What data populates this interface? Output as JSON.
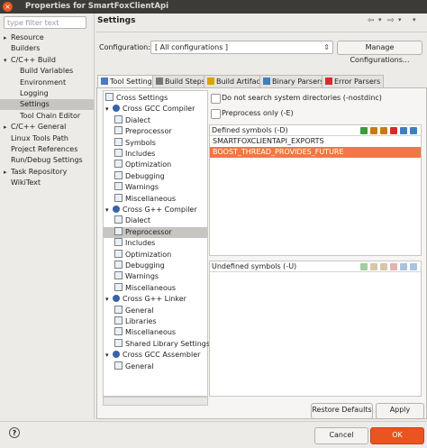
{
  "window": {
    "title": "Properties for SmartFoxClientApi",
    "close_glyph": "×"
  },
  "filter": {
    "placeholder": "type filter text"
  },
  "nav": {
    "items": [
      {
        "label": "Resource",
        "arrow": "▸"
      },
      {
        "label": "Builders",
        "arrow": ""
      },
      {
        "label": "C/C++ Build",
        "arrow": "▾"
      },
      {
        "label": "Build Variables",
        "arrow": ""
      },
      {
        "label": "Environment",
        "arrow": ""
      },
      {
        "label": "Logging",
        "arrow": ""
      },
      {
        "label": "Settings",
        "arrow": ""
      },
      {
        "label": "Tool Chain Editor",
        "arrow": ""
      },
      {
        "label": "C/C++ General",
        "arrow": "▸"
      },
      {
        "label": "Linux Tools Path",
        "arrow": ""
      },
      {
        "label": "Project References",
        "arrow": ""
      },
      {
        "label": "Run/Debug Settings",
        "arrow": ""
      },
      {
        "label": "Task Repository",
        "arrow": "▸"
      },
      {
        "label": "WikiText",
        "arrow": ""
      }
    ]
  },
  "header": {
    "title": "Settings",
    "back_glyph": "⇦",
    "back_menu_glyph": "▾",
    "fwd_glyph": "⇨",
    "fwd_menu_glyph": "▾",
    "more_glyph": "▾"
  },
  "configuration": {
    "label": "Configuration:",
    "value": "[ All configurations ]",
    "chevron": "⇕",
    "manage_label": "Manage Configurations..."
  },
  "tabs": [
    {
      "label": "Tool Settings",
      "icon_color": "#4a7bc2"
    },
    {
      "label": "Build Steps",
      "icon_color": "#777777"
    },
    {
      "label": "Build Artifact",
      "icon_color": "#d9a300"
    },
    {
      "label": "Binary Parsers",
      "icon_color": "#3f7fbf"
    },
    {
      "label": "Error Parsers",
      "icon_color": "#d22d2d"
    }
  ],
  "tool_tree": [
    {
      "label": "Cross Settings",
      "kind": "leaf",
      "indent": 0
    },
    {
      "label": "Cross GCC Compiler",
      "kind": "group",
      "indent": 0
    },
    {
      "label": "Dialect",
      "kind": "leaf",
      "indent": 1
    },
    {
      "label": "Preprocessor",
      "kind": "leaf",
      "indent": 1
    },
    {
      "label": "Symbols",
      "kind": "leaf",
      "indent": 1
    },
    {
      "label": "Includes",
      "kind": "leaf",
      "indent": 1
    },
    {
      "label": "Optimization",
      "kind": "leaf",
      "indent": 1
    },
    {
      "label": "Debugging",
      "kind": "leaf",
      "indent": 1
    },
    {
      "label": "Warnings",
      "kind": "leaf",
      "indent": 1
    },
    {
      "label": "Miscellaneous",
      "kind": "leaf",
      "indent": 1
    },
    {
      "label": "Cross G++ Compiler",
      "kind": "group",
      "indent": 0
    },
    {
      "label": "Dialect",
      "kind": "leaf",
      "indent": 1
    },
    {
      "label": "Preprocessor",
      "kind": "leaf",
      "indent": 1
    },
    {
      "label": "Includes",
      "kind": "leaf",
      "indent": 1
    },
    {
      "label": "Optimization",
      "kind": "leaf",
      "indent": 1
    },
    {
      "label": "Debugging",
      "kind": "leaf",
      "indent": 1
    },
    {
      "label": "Warnings",
      "kind": "leaf",
      "indent": 1
    },
    {
      "label": "Miscellaneous",
      "kind": "leaf",
      "indent": 1
    },
    {
      "label": "Cross G++ Linker",
      "kind": "group",
      "indent": 0
    },
    {
      "label": "General",
      "kind": "leaf",
      "indent": 1
    },
    {
      "label": "Libraries",
      "kind": "leaf",
      "indent": 1
    },
    {
      "label": "Miscellaneous",
      "kind": "leaf",
      "indent": 1
    },
    {
      "label": "Shared Library Settings",
      "kind": "leaf",
      "indent": 1
    },
    {
      "label": "Cross GCC Assembler",
      "kind": "group",
      "indent": 0
    },
    {
      "label": "General",
      "kind": "leaf",
      "indent": 1
    }
  ],
  "options": {
    "no_system_dirs": "Do not search system directories (-nostdinc)",
    "preprocess_only": "Preprocess only (-E)"
  },
  "defined": {
    "header": "Defined symbols (-D)",
    "items": [
      "SMARTFOXCLIENTAPI_EXPORTS",
      "BOOST_THREAD_PROVIDES_FUTURE"
    ],
    "icon_colors": [
      "#3c9a3c",
      "#c77a1a",
      "#c77a1a",
      "#d22d2d",
      "#3f7fbf",
      "#3f7fbf"
    ]
  },
  "undefined": {
    "header": "Undefined symbols (-U)",
    "icon_colors": [
      "#9fce9f",
      "#d9c6a8",
      "#d9c6a8",
      "#e6b1b1",
      "#a9c3e0",
      "#a9c3e0"
    ]
  },
  "buttons": {
    "restore": "Restore Defaults",
    "apply": "Apply",
    "cancel": "Cancel",
    "ok": "OK"
  },
  "help_glyph": "?"
}
